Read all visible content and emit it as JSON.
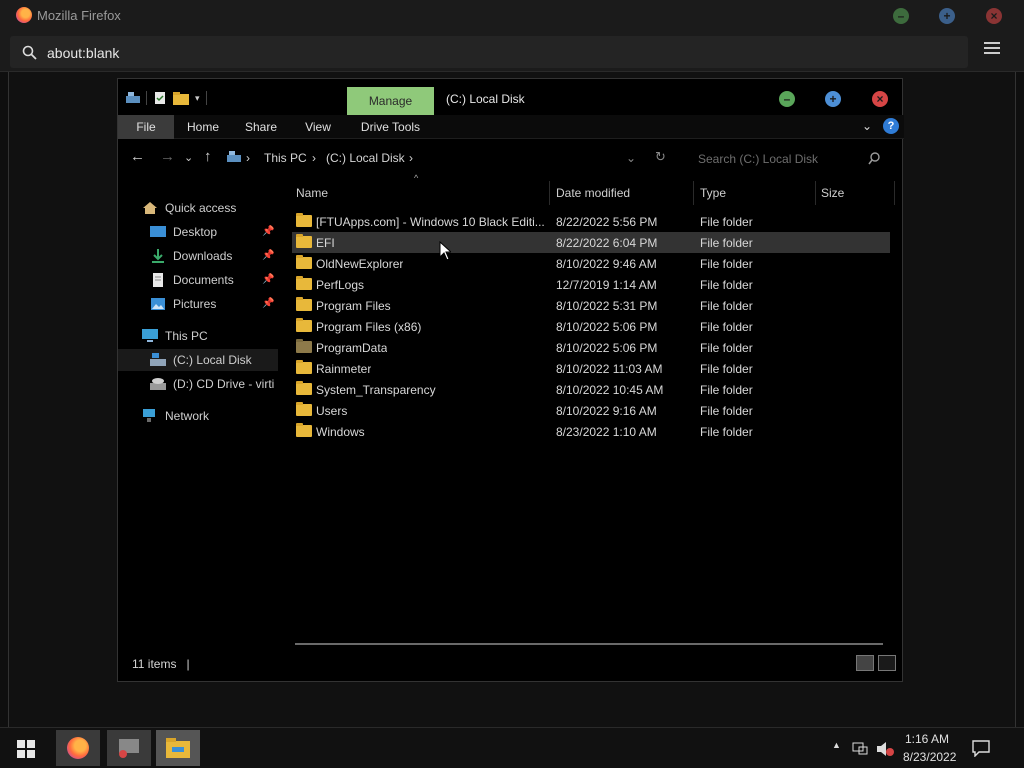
{
  "firefox": {
    "window_title": "Mozilla Firefox",
    "url": "about:blank"
  },
  "explorer": {
    "manage_tab": "Manage",
    "title": "(C:) Local Disk",
    "ribbon_tabs": [
      "File",
      "Home",
      "Share",
      "View",
      "Drive Tools"
    ],
    "breadcrumb": [
      "This PC",
      "(C:) Local Disk"
    ],
    "search_placeholder": "Search (C:) Local Disk",
    "nav": {
      "quick_access": "Quick access",
      "desktop": "Desktop",
      "downloads": "Downloads",
      "documents": "Documents",
      "pictures": "Pictures",
      "this_pc": "This PC",
      "local_disk": "(C:) Local Disk",
      "cd_drive": "(D:) CD Drive - virtio",
      "network": "Network"
    },
    "columns": [
      "Name",
      "Date modified",
      "Type",
      "Size"
    ],
    "files": [
      {
        "name": "[FTUApps.com] - Windows 10 Black Editi...",
        "date": "8/22/2022 5:56 PM",
        "type": "File folder"
      },
      {
        "name": "EFI",
        "date": "8/22/2022 6:04 PM",
        "type": "File folder"
      },
      {
        "name": "OldNewExplorer",
        "date": "8/10/2022 9:46 AM",
        "type": "File folder"
      },
      {
        "name": "PerfLogs",
        "date": "12/7/2019 1:14 AM",
        "type": "File folder"
      },
      {
        "name": "Program Files",
        "date": "8/10/2022 5:31 PM",
        "type": "File folder"
      },
      {
        "name": "Program Files (x86)",
        "date": "8/10/2022 5:06 PM",
        "type": "File folder"
      },
      {
        "name": "ProgramData",
        "date": "8/10/2022 5:06 PM",
        "type": "File folder"
      },
      {
        "name": "Rainmeter",
        "date": "8/10/2022 11:03 AM",
        "type": "File folder"
      },
      {
        "name": "System_Transparency",
        "date": "8/10/2022 10:45 AM",
        "type": "File folder"
      },
      {
        "name": "Users",
        "date": "8/10/2022 9:16 AM",
        "type": "File folder"
      },
      {
        "name": "Windows",
        "date": "8/23/2022 1:10 AM",
        "type": "File folder"
      }
    ],
    "status": "11 items"
  },
  "taskbar": {
    "time": "1:16 AM",
    "date": "8/23/2022"
  },
  "colors": {
    "manage_accent": "#8fc97a",
    "help_blue": "#2f7cd6",
    "folder_yellow": "#e8b83a",
    "min_green": "#5aa65a",
    "max_blue": "#4d8fd6",
    "close_red": "#d64545"
  }
}
